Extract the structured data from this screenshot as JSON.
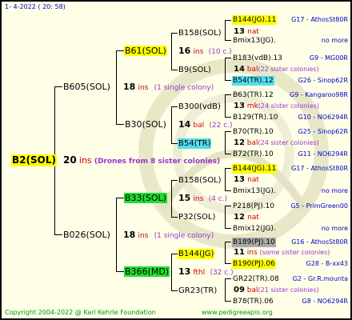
{
  "header": {
    "date_text": "1-  4-2022 ( 20: 58)"
  },
  "footer": {
    "copyright": "Copyright 2004-2022 @ Karl Kehrle Foundation",
    "website": "www.pedigreeapis.org"
  },
  "colors": {
    "yellow": "#ffff00",
    "green": "#22dd33",
    "cyan": "#55ddee",
    "gray": "#aaaaaa",
    "code_blue": "#0000cc",
    "ins_red": "#cc0000",
    "note_purple": "#9933cc",
    "footer_green": "#009900"
  },
  "root": {
    "name": "B2(SOL)",
    "count": "20",
    "type": "ins",
    "note": "(Drones from 8 sister colonies)"
  },
  "gen1": {
    "upper": {
      "name": "B605(SOL)",
      "count": "18",
      "type": "ins",
      "note": "(1 single colony)"
    },
    "lower": {
      "name": "B026(SOL)",
      "count": "18",
      "type": "ins",
      "note": "(1 single colony)"
    }
  },
  "gen2": {
    "a": {
      "name": "B61(SOL)",
      "count": "16",
      "type": "ins",
      "note": "(10 c.)"
    },
    "b": {
      "name": "B30(SOL)",
      "count": "14",
      "type": "bal",
      "note": "(22 c.)"
    },
    "c": {
      "name": "B33(SOL)",
      "count": "15",
      "type": "ins",
      "note": "(4 c.)"
    },
    "d": {
      "name": "B366(MD)",
      "count": "13",
      "type": "fthl",
      "note": "(32 c.)"
    }
  },
  "gen3": {
    "a1": {
      "name": "B158(SOL)",
      "count": "13",
      "type": "nat"
    },
    "a2": {
      "name": "B9(SOL)",
      "count": "14",
      "type": "bal",
      "note": "(22 sister colonies)"
    },
    "b1": {
      "name": "B300(vdB)",
      "count": "13",
      "type": "mk",
      "note": "(24 sister colonies)"
    },
    "b2": {
      "name": "B54(TR)",
      "count": "12",
      "type": "bal",
      "note": "(24 sister colonies)"
    },
    "c1": {
      "name": "B158(SOL)",
      "count": "13",
      "type": "nat"
    },
    "c2": {
      "name": "P32(SOL)",
      "count": "12",
      "type": "nat"
    },
    "d1": {
      "name": "B144(JG)",
      "count": "11",
      "type": "ins",
      "note": "(some sister colonies)"
    },
    "d2": {
      "name": "GR23(TR)",
      "count": "09",
      "type": "bal",
      "note": "(21 sister colonies)"
    }
  },
  "gen4": {
    "a1m": {
      "name": "B144(JG).11",
      "code": "G17 - AthosSt80R"
    },
    "a1f": {
      "name": "Bmix13(JG).",
      "code": "no more"
    },
    "a2m": {
      "name": "B183(vdB).13",
      "code": "G9 - MG00R"
    },
    "a2f": {
      "name": "B54(TR).12",
      "code": "G26 - Sinop62R"
    },
    "b1m": {
      "name": "B63(TR).12",
      "code": "G9 - Kangaroo98R"
    },
    "b1f": {
      "name": "B129(TR).10",
      "code": "G10 - NO6294R"
    },
    "b2m": {
      "name": "B70(TR).10",
      "code": "G25 - Sinop62R"
    },
    "b2f": {
      "name": "B72(TR).10",
      "code": "G11 - NO6294R"
    },
    "c1m": {
      "name": "B144(JG).11",
      "code": "G17 - AthosSt80R"
    },
    "c1f": {
      "name": "Bmix13(JG).",
      "code": "no more"
    },
    "c2m": {
      "name": "P218(PJ).10",
      "code": "G5 - PrimGreen00"
    },
    "c2f": {
      "name": "Bmix12(JG).",
      "code": "no more"
    },
    "d1m": {
      "name": "B189(PJ).10",
      "code": "G16 - AthosSt80R"
    },
    "d1f": {
      "name": "B190(PJ).06",
      "code": "G28 - B-xx43"
    },
    "d2m": {
      "name": "GR22(TR).08",
      "code": "G2 - Gr.R.mounta"
    },
    "d2f": {
      "name": "B78(TR).06",
      "code": "G8 - NO6294R"
    }
  }
}
